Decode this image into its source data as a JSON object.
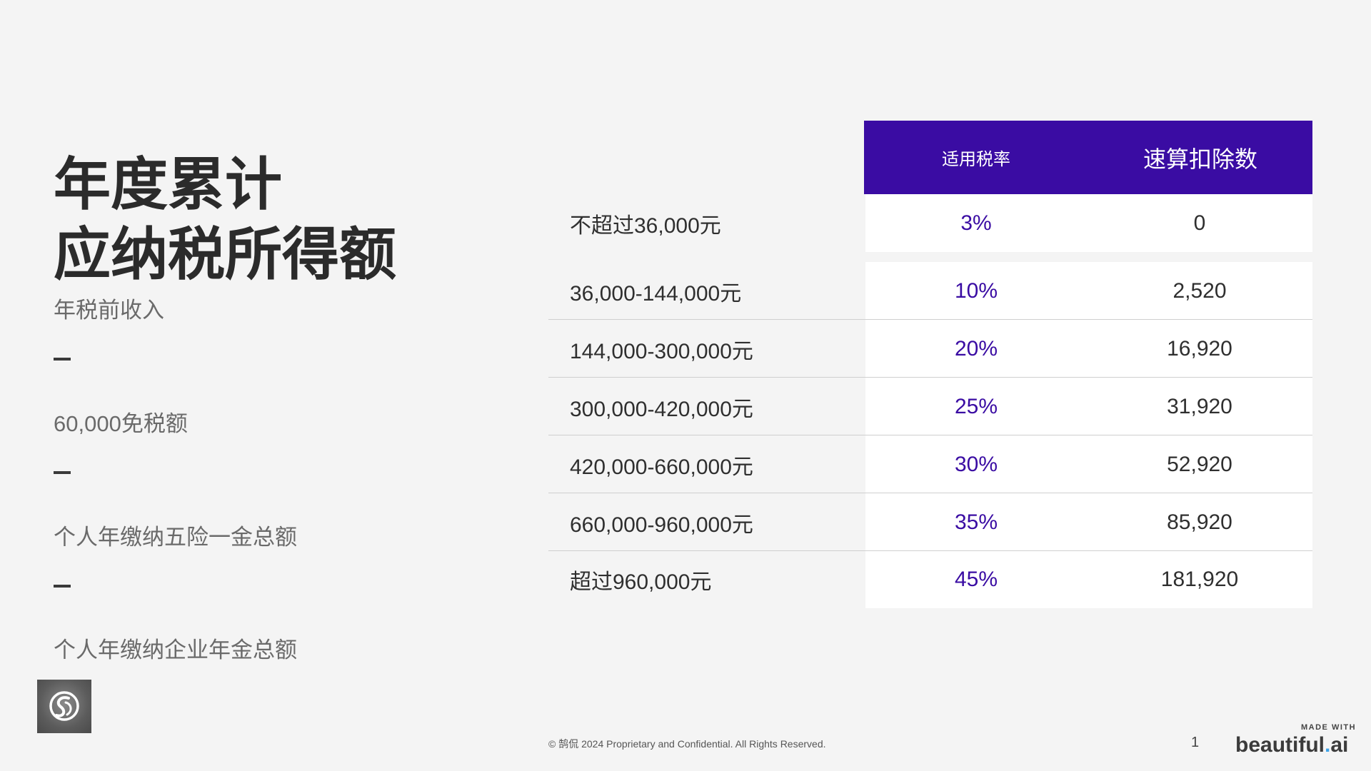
{
  "title": {
    "line1": "年度累计",
    "line2": "应纳税所得额"
  },
  "description": {
    "items": [
      "年税前收入",
      "60,000免税额",
      "个人年缴纳五险一金总额",
      "个人年缴纳企业年金总额"
    ]
  },
  "table": {
    "headers": {
      "rate": "适用税率",
      "deduction": "速算扣除数"
    },
    "rows": [
      {
        "bracket": "不超过36,000元",
        "rate": "3%",
        "deduction": "0"
      },
      {
        "bracket": "36,000-144,000元",
        "rate": "10%",
        "deduction": "2,520"
      },
      {
        "bracket": "144,000-300,000元",
        "rate": "20%",
        "deduction": "16,920"
      },
      {
        "bracket": "300,000-420,000元",
        "rate": "25%",
        "deduction": "31,920"
      },
      {
        "bracket": "420,000-660,000元",
        "rate": "30%",
        "deduction": "52,920"
      },
      {
        "bracket": "660,000-960,000元",
        "rate": "35%",
        "deduction": "85,920"
      },
      {
        "bracket": "超过960,000元",
        "rate": "45%",
        "deduction": "181,920"
      }
    ]
  },
  "footer": {
    "copyright": "© 鹄侃 2024 Proprietary and Confidential. All Rights Reserved.",
    "page_number": "1",
    "made_with": "MADE WITH",
    "brand_main": "beautiful",
    "brand_dot": ".",
    "brand_suffix": "ai"
  },
  "colors": {
    "accent": "#3a0ca3",
    "background": "#f4f4f4"
  },
  "icons": {
    "logo": "swan-logo-icon"
  }
}
